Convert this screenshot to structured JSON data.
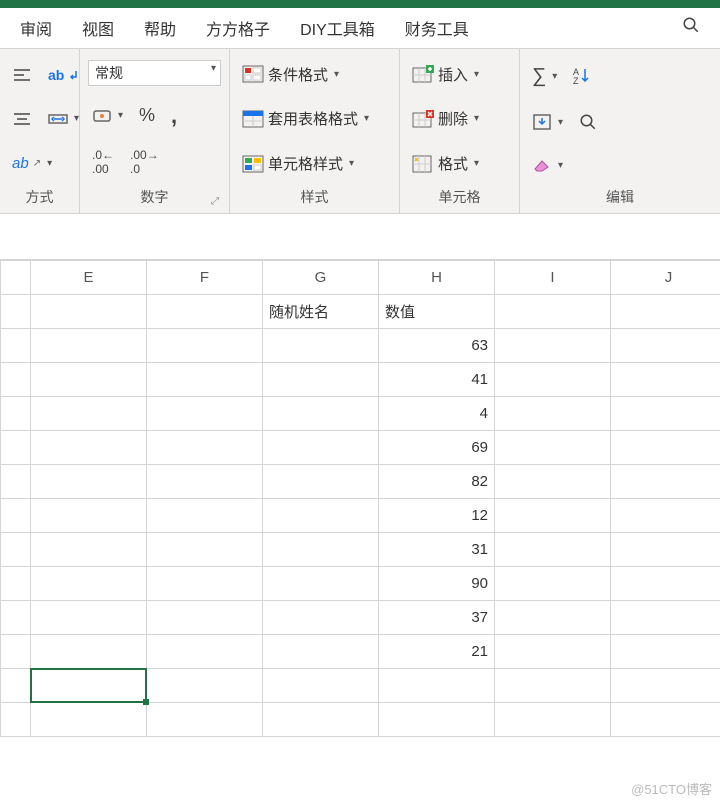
{
  "tabs": {
    "review": "审阅",
    "view": "视图",
    "help": "帮助",
    "fangfang": "方方格子",
    "diy": "DIY工具箱",
    "finance": "财务工具"
  },
  "ribbon": {
    "align_label": "方式",
    "number_label": "数字",
    "styles_label": "样式",
    "cells_label": "单元格",
    "edit_label": "编辑",
    "format_general": "常规",
    "cond_format": "条件格式",
    "table_format": "套用表格格式",
    "cell_styles": "单元格样式",
    "insert": "插入",
    "delete": "删除",
    "format": "格式"
  },
  "columns": [
    "E",
    "F",
    "G",
    "H",
    "I",
    "J"
  ],
  "headers": {
    "g": "随机姓名",
    "h": "数值"
  },
  "values": [
    63,
    41,
    4,
    69,
    82,
    12,
    31,
    90,
    37,
    21
  ],
  "watermark": "@51CTO博客"
}
